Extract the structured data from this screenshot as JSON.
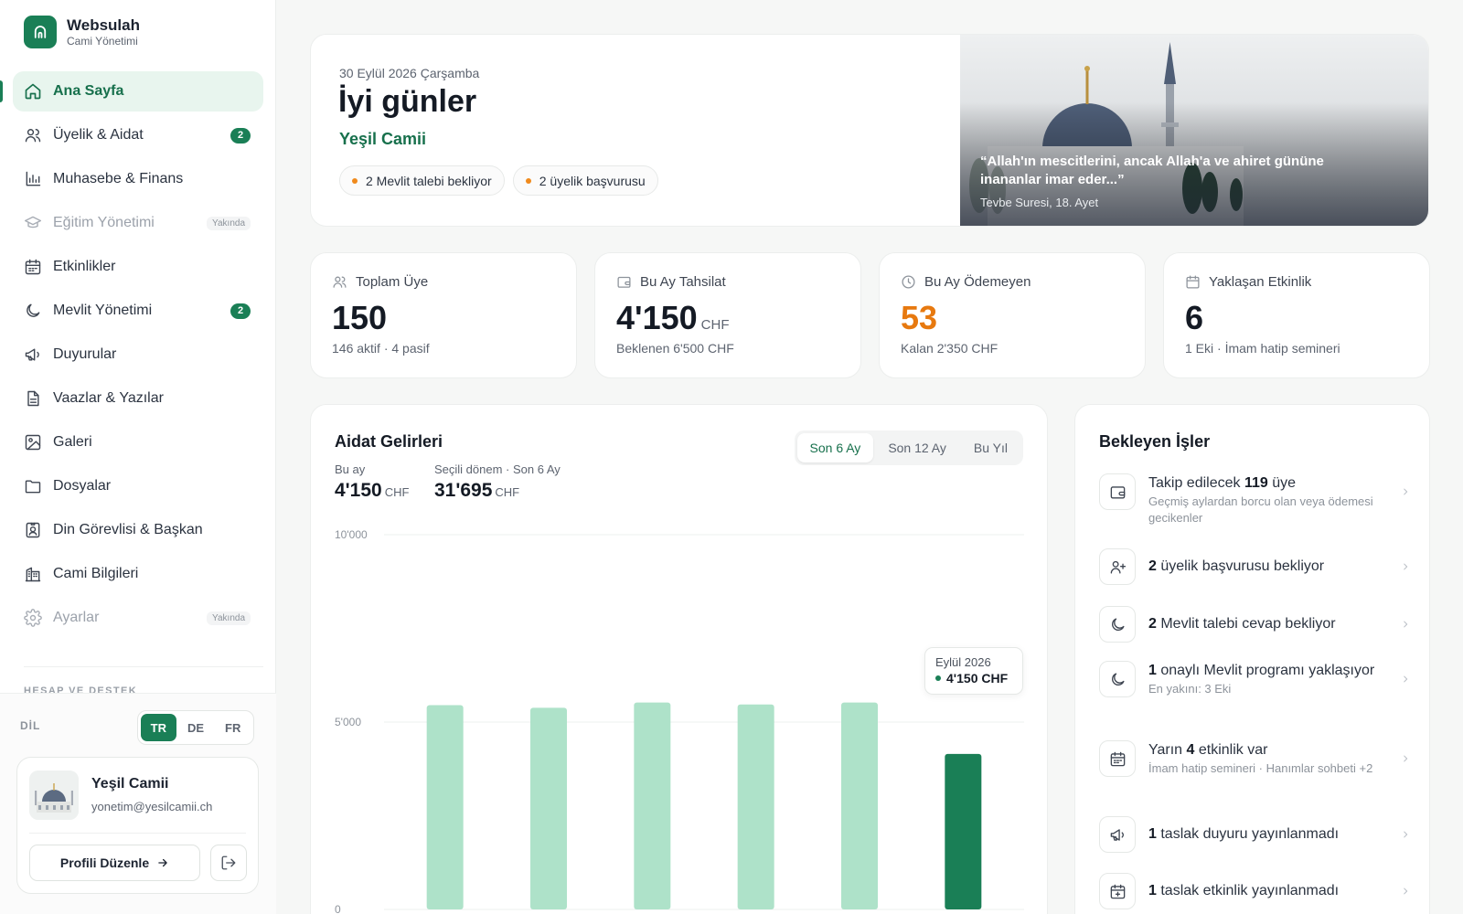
{
  "brand": {
    "name": "Websulah",
    "subtitle": "Cami Yönetimi"
  },
  "nav": [
    {
      "label": "Ana Sayfa",
      "icon": "home-icon",
      "active": true
    },
    {
      "label": "Üyelik & Aidat",
      "icon": "users-icon",
      "badge": "2"
    },
    {
      "label": "Muhasebe & Finans",
      "icon": "bar-chart-icon"
    },
    {
      "label": "Eğitim Yönetimi",
      "icon": "graduation-cap-icon",
      "soon": "Yakında",
      "disabled": true
    },
    {
      "label": "Etkinlikler",
      "icon": "calendar-icon"
    },
    {
      "label": "Mevlit Yönetimi",
      "icon": "moon-icon",
      "badge": "2"
    },
    {
      "label": "Duyurular",
      "icon": "megaphone-icon"
    },
    {
      "label": "Vaazlar & Yazılar",
      "icon": "document-icon"
    },
    {
      "label": "Galeri",
      "icon": "image-icon"
    },
    {
      "label": "Dosyalar",
      "icon": "folder-icon"
    },
    {
      "label": "Din Görevlisi & Başkan",
      "icon": "id-badge-icon"
    },
    {
      "label": "Cami Bilgileri",
      "icon": "building-icon"
    },
    {
      "label": "Ayarlar",
      "icon": "gear-icon",
      "soon": "Yakında",
      "disabled": true
    }
  ],
  "section_title": "HESAP VE DESTEK",
  "language": {
    "label": "DİL",
    "options": [
      "TR",
      "DE",
      "FR"
    ],
    "selected": "TR"
  },
  "profile": {
    "name": "Yeşil Camii",
    "email": "yonetim@yesilcamii.ch",
    "edit_label": "Profili Düzenle"
  },
  "hero": {
    "date": "30 Eylül 2026 Çarşamba",
    "greeting": "İyi günler",
    "mosque": "Yeşil Camii",
    "pills": [
      "2 Mevlit talebi bekliyor",
      "2 üyelik başvurusu"
    ],
    "quote": "“Allah'ın mescitlerini, ancak Allah'a ve ahiret gününe inananlar imar eder...”",
    "quote_source": "Tevbe Suresi, 18. Ayet"
  },
  "stats": [
    {
      "label": "Toplam Üye",
      "value": "150",
      "unit": "",
      "sub": "146 aktif · 4 pasif",
      "icon": "users-icon"
    },
    {
      "label": "Bu Ay Tahsilat",
      "value": "4'150",
      "unit": "CHF",
      "sub": "Beklenen 6'500 CHF",
      "icon": "wallet-icon"
    },
    {
      "label": "Bu Ay Ödemeyen",
      "value": "53",
      "unit": "",
      "sub": "Kalan 2'350 CHF",
      "icon": "clock-icon",
      "warn": true
    },
    {
      "label": "Yaklaşan Etkinlik",
      "value": "6",
      "unit": "",
      "sub": "1 Eki · İmam hatip semineri",
      "icon": "calendar-icon"
    }
  ],
  "income": {
    "title": "Aidat Gelirleri",
    "tabs": [
      "Son 6 Ay",
      "Son 12 Ay",
      "Bu Yıl"
    ],
    "selected_tab": "Son 6 Ay",
    "this_month_label": "Bu ay",
    "this_month_value": "4'150",
    "period_label": "Seçili dönem · Son 6 Ay",
    "period_value": "31'695",
    "unit": "CHF",
    "tooltip": {
      "month": "Eylül 2026",
      "value": "4'150 CHF"
    }
  },
  "chart_data": {
    "type": "bar",
    "categories": [
      "",
      "",
      "",
      "",
      "",
      "Eylül 2026"
    ],
    "values": [
      5450,
      5380,
      5520,
      5470,
      5520,
      4150
    ],
    "ylim": [
      0,
      10000
    ],
    "yticks": [
      "0",
      "5'000",
      "10'000"
    ],
    "ytick_values": [
      0,
      5000,
      10000
    ],
    "grid": true,
    "bar_color": "#aee2c9",
    "highlight_color": "#1a7f56",
    "highlight_index": 5
  },
  "tasks": {
    "title": "Bekleyen İşler",
    "items": [
      {
        "pre": "Takip edilecek ",
        "bold": "119",
        "post": " üye",
        "sub": "Geçmiş aylardan borcu olan veya ödemesi gecikenler",
        "icon": "wallet-icon"
      },
      {
        "pre": "",
        "bold": "2",
        "post": " üyelik başvurusu bekliyor",
        "sub": "",
        "icon": "user-plus-icon"
      },
      {
        "pre": "",
        "bold": "2",
        "post": " Mevlit talebi cevap bekliyor",
        "sub": "",
        "icon": "moon-icon"
      },
      {
        "pre": "",
        "bold": "1",
        "post": " onaylı Mevlit programı yaklaşıyor",
        "sub": "En yakını: 3 Eki",
        "icon": "moon-icon"
      },
      {
        "pre": "Yarın ",
        "bold": "4",
        "post": " etkinlik var",
        "sub": "İmam hatip semineri · Hanımlar sohbeti +2",
        "icon": "calendar-icon"
      },
      {
        "pre": "",
        "bold": "1",
        "post": " taslak duyuru yayınlanmadı",
        "sub": "",
        "icon": "megaphone-icon"
      },
      {
        "pre": "",
        "bold": "1",
        "post": " taslak etkinlik yayınlanmadı",
        "sub": "",
        "icon": "calendar-plus-icon"
      }
    ]
  }
}
